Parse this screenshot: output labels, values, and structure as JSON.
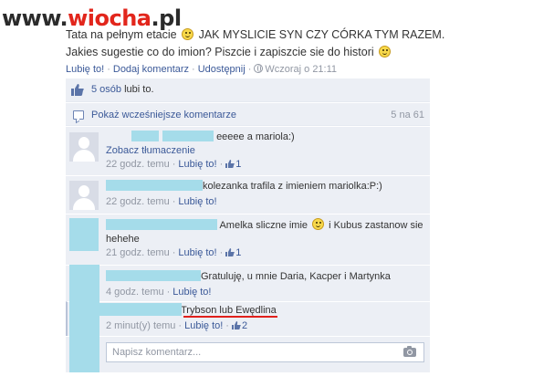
{
  "watermark": {
    "part1": "www.",
    "part2": "wiocha",
    "part3": ".pl"
  },
  "post": {
    "line1_a": "Tata na pełnym etacie",
    "line1_b": "JAK MYSLICIE SYN CZY CÓRKA TYM RAZEM.",
    "line2": "Jakies sugestie co do imion? Piszcie i zapiszcie sie do histori"
  },
  "actions": {
    "like": "Lubię to!",
    "comment": "Dodaj komentarz",
    "share": "Udostępnij",
    "time": "Wczoraj o 21:11"
  },
  "likes": {
    "people": "5 osób",
    "suffix": "lubi to."
  },
  "previous": {
    "label": "Pokaż wcześniejsze komentarze",
    "count": "5 na 61"
  },
  "comments": [
    {
      "text": "eeeee a mariola:)",
      "translate": "Zobacz tłumaczenie",
      "time": "22 godz. temu",
      "like": "Lubię to!",
      "likes": "1"
    },
    {
      "text": "kolezanka trafila z imieniem mariolka:P:)",
      "time": "22 godz. temu",
      "like": "Lubię to!"
    },
    {
      "text_a": "Amelka sliczne imie",
      "text_b": "i Kubus zastanow sie",
      "text_c": "hehehe",
      "time": "21 godz. temu",
      "like": "Lubię to!",
      "likes": "1"
    },
    {
      "text": "Gratuluję, u mnie Daria, Kacper i Martynka",
      "time": "4 godz. temu",
      "like": "Lubię to!"
    },
    {
      "text": "Trybson lub Ewędlina",
      "time": "2 minut(y) temu",
      "like": "Lubię to!",
      "likes": "2"
    }
  ],
  "new_comment": {
    "placeholder": "Napisz komentarz..."
  },
  "colors": {
    "link": "#3b5998",
    "muted": "#9197a3",
    "ufi_bg": "#eceff5",
    "redaction": "#a5dcea",
    "watermark_red": "#e2261c",
    "underline_red": "#e0201b"
  }
}
